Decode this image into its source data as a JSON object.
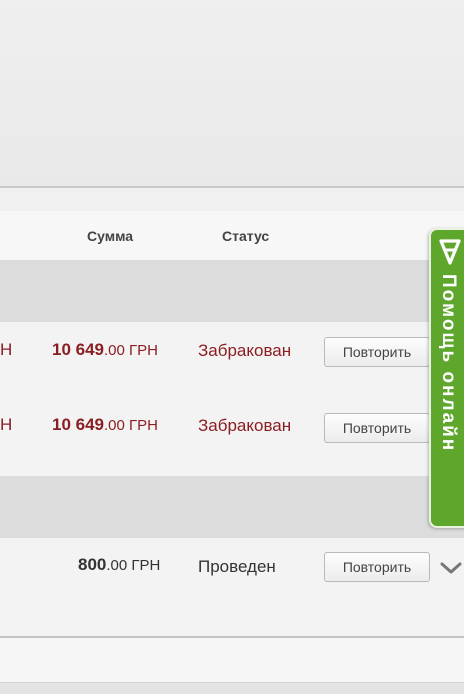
{
  "table": {
    "columns": {
      "amount": "Сумма",
      "status": "Статус"
    },
    "rows": [
      {
        "cut_text": "Н",
        "amount_int": "10 649",
        "amount_dec": ".00 ГРН",
        "status": "Забракован",
        "button": "Повторить"
      },
      {
        "cut_text": "Н",
        "amount_int": "10 649",
        "amount_dec": ".00 ГРН",
        "status": "Забракован",
        "button": "Повторить"
      },
      {
        "cut_text": "",
        "amount_int": "800",
        "amount_dec": ".00 ГРН",
        "status": "Проведен",
        "button": "Повторить"
      }
    ]
  },
  "help_tab": {
    "label": "Помощь онлайн",
    "icon": "chat-icon"
  },
  "icons": {
    "expand": "chevron-down-icon"
  },
  "colors": {
    "rejected": "#8b1e22",
    "help_green": "#5fa62d"
  }
}
